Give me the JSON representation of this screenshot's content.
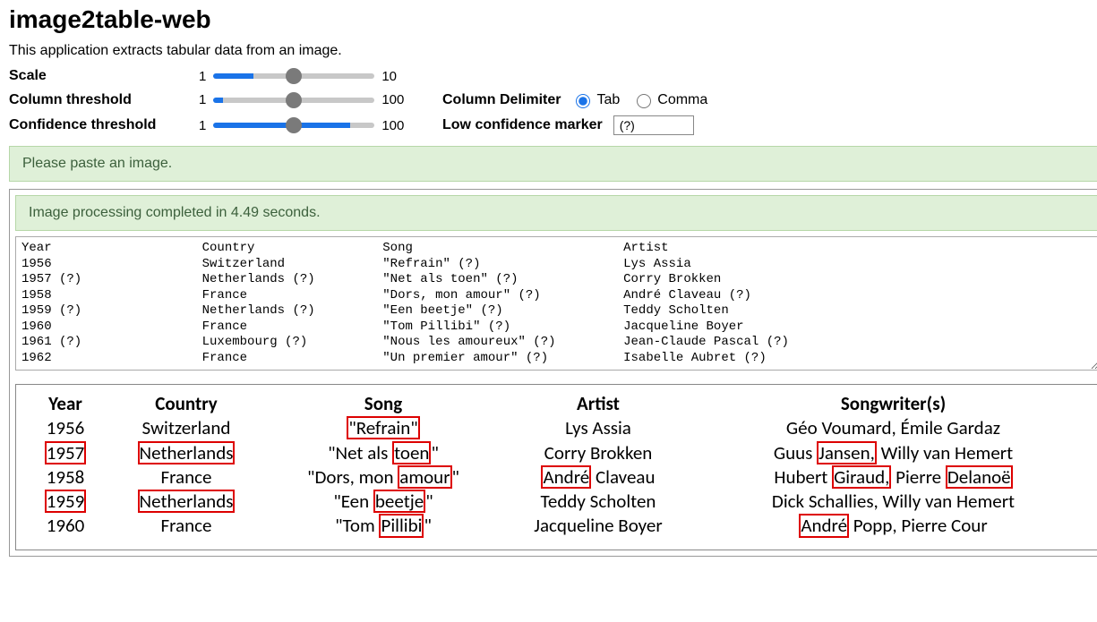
{
  "title": "image2table-web",
  "description": "This application extracts tabular data from an image.",
  "sliders": {
    "scale": {
      "label": "Scale",
      "min": "1",
      "max": "10",
      "pct": 25
    },
    "col": {
      "label": "Column threshold",
      "min": "1",
      "max": "100",
      "pct": 6
    },
    "conf": {
      "label": "Confidence threshold",
      "min": "1",
      "max": "100",
      "pct": 85
    }
  },
  "delimiter": {
    "label": "Column Delimiter",
    "opt1": "Tab",
    "opt2": "Comma"
  },
  "lowconf": {
    "label": "Low confidence marker",
    "value": "(?)"
  },
  "banner1": "Please paste an image.",
  "banner2": "Image processing completed in 4.49 seconds.",
  "output": {
    "cols": [
      "Year",
      "Country",
      "Song",
      "Artist"
    ],
    "rows": [
      [
        "1956",
        "Switzerland",
        "\"Refrain\" (?)",
        "Lys Assia"
      ],
      [
        "1957 (?)",
        "Netherlands (?)",
        "\"Net als toen\" (?)",
        "Corry Brokken"
      ],
      [
        "1958",
        "France",
        "\"Dors, mon amour\" (?)",
        "André Claveau (?)"
      ],
      [
        "1959 (?)",
        "Netherlands (?)",
        "\"Een beetje\" (?)",
        "Teddy Scholten"
      ],
      [
        "1960",
        "France",
        "\"Tom Pillibi\" (?)",
        "Jacqueline Boyer"
      ],
      [
        "1961 (?)",
        "Luxembourg (?)",
        "\"Nous les amoureux\" (?)",
        "Jean-Claude Pascal (?)"
      ],
      [
        "1962",
        "France",
        "\"Un premier amour\" (?)",
        "Isabelle Aubret (?)"
      ]
    ]
  },
  "preview": {
    "headers": [
      "Year",
      "Country",
      "Song",
      "Artist",
      "Songwriter(s)"
    ],
    "rows": [
      {
        "year": "1956",
        "country": "Switzerland",
        "song": "\"Refrain\"",
        "artist": "Lys Assia",
        "sw": "Géo Voumard, Émile Gardaz",
        "m": {
          "song_full": true
        }
      },
      {
        "year": "1957",
        "country": "Netherlands",
        "song": "\"Net als toen\"",
        "artist": "Corry Brokken",
        "sw": "Guus Jansen, Willy van Hemert",
        "m": {
          "year": true,
          "country": true,
          "song_word": "toen",
          "sw_word": "Jansen,"
        }
      },
      {
        "year": "1958",
        "country": "France",
        "song": "\"Dors, mon amour\"",
        "artist": "André Claveau",
        "sw": "Hubert Giraud, Pierre Delanoë",
        "m": {
          "song_word": "amour",
          "artist_word": "André",
          "sw_word": "Giraud,",
          "sw_word2": "Delanoë"
        }
      },
      {
        "year": "1959",
        "country": "Netherlands",
        "song": "\"Een beetje\"",
        "artist": "Teddy Scholten",
        "sw": "Dick Schallies, Willy van Hemert",
        "m": {
          "year": true,
          "country": true,
          "song_word": "beetje"
        }
      },
      {
        "year": "1960",
        "country": "France",
        "song": "\"Tom Pillibi\"",
        "artist": "Jacqueline Boyer",
        "sw": "André Popp, Pierre Cour",
        "m": {
          "song_word": "Pillibi",
          "sw_word": "André"
        }
      }
    ]
  }
}
